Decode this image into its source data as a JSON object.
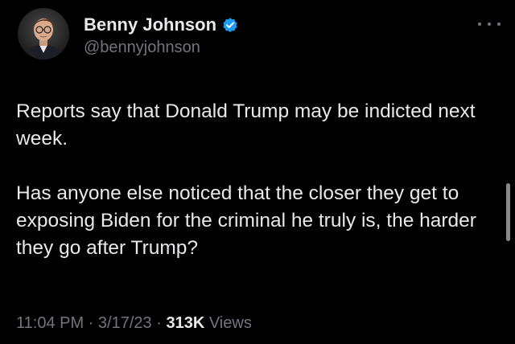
{
  "tweet": {
    "author": {
      "display_name": "Benny Johnson",
      "handle": "@bennyjohnson",
      "verified": true,
      "avatar_icon": "profile-photo",
      "verified_icon": "verified-badge-icon",
      "verified_color": "#1d9bf0"
    },
    "body": {
      "paragraph_1": "Reports say that Donald Trump may be indicted next week.",
      "paragraph_2": "Has anyone else noticed that the closer they get to exposing Biden for the criminal he truly is, the harder they go after Trump?"
    },
    "meta": {
      "time": "11:04 PM",
      "separator": "·",
      "date": "3/17/23",
      "views_count": "313K",
      "views_label": "Views"
    },
    "more_icon": "more-options-icon"
  },
  "colors": {
    "background": "#000000",
    "primary_text": "#e7e9ea",
    "secondary_text": "#71767b"
  }
}
